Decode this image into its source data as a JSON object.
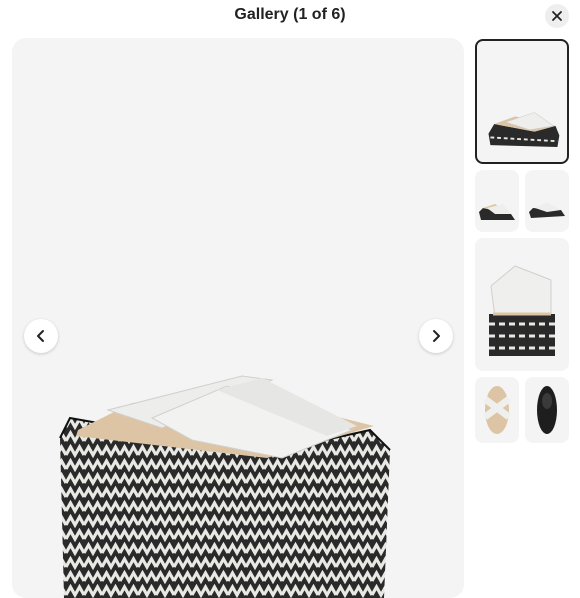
{
  "header": {
    "title": "Gallery (1 of 6)"
  },
  "icons": {
    "close": "close-icon",
    "prev": "chevron-left-icon",
    "next": "chevron-right-icon"
  },
  "colors": {
    "background": "#f4f4f4",
    "active_border": "#222222"
  },
  "gallery": {
    "current_index": 1,
    "total": 6
  }
}
